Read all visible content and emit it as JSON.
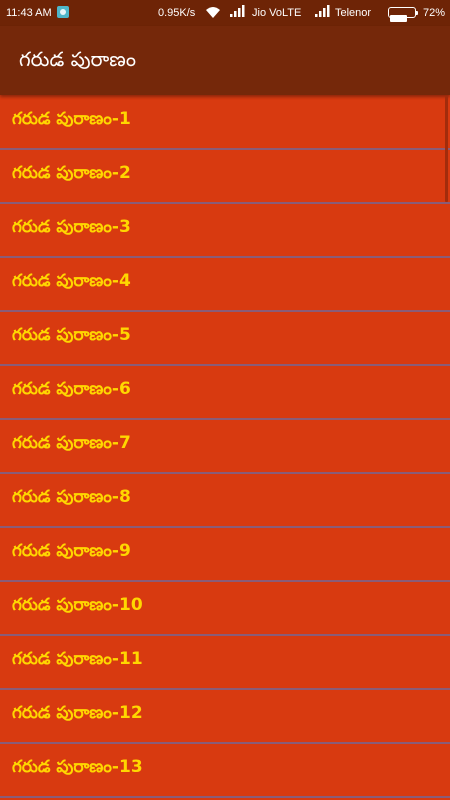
{
  "status_bar": {
    "time": "11:43 AM",
    "net_speed": "0.95K/s",
    "carrier_1": "Jio VoLTE",
    "carrier_2": "Telenor",
    "battery_percent": "72%",
    "battery_level": 0.72
  },
  "app_bar": {
    "title": "గరుడ పురాణం"
  },
  "list": {
    "items": [
      {
        "label": "గరుడ పురాణం-1"
      },
      {
        "label": "గరుడ పురాణం-2"
      },
      {
        "label": "గరుడ పురాణం-3"
      },
      {
        "label": "గరుడ పురాణం-4"
      },
      {
        "label": "గరుడ పురాణం-5"
      },
      {
        "label": "గరుడ పురాణం-6"
      },
      {
        "label": "గరుడ పురాణం-7"
      },
      {
        "label": "గరుడ పురాణం-8"
      },
      {
        "label": "గరుడ పురాణం-9"
      },
      {
        "label": "గరుడ పురాణం-10"
      },
      {
        "label": "గరుడ పురాణం-11"
      },
      {
        "label": "గరుడ పురాణం-12"
      },
      {
        "label": "గరుడ పురాణం-13"
      }
    ]
  },
  "colors": {
    "status_bar": "#6e2406",
    "app_bar": "#75280a",
    "list_background": "#d83a10",
    "item_text": "#ffd700",
    "divider": "#8a5c78"
  }
}
